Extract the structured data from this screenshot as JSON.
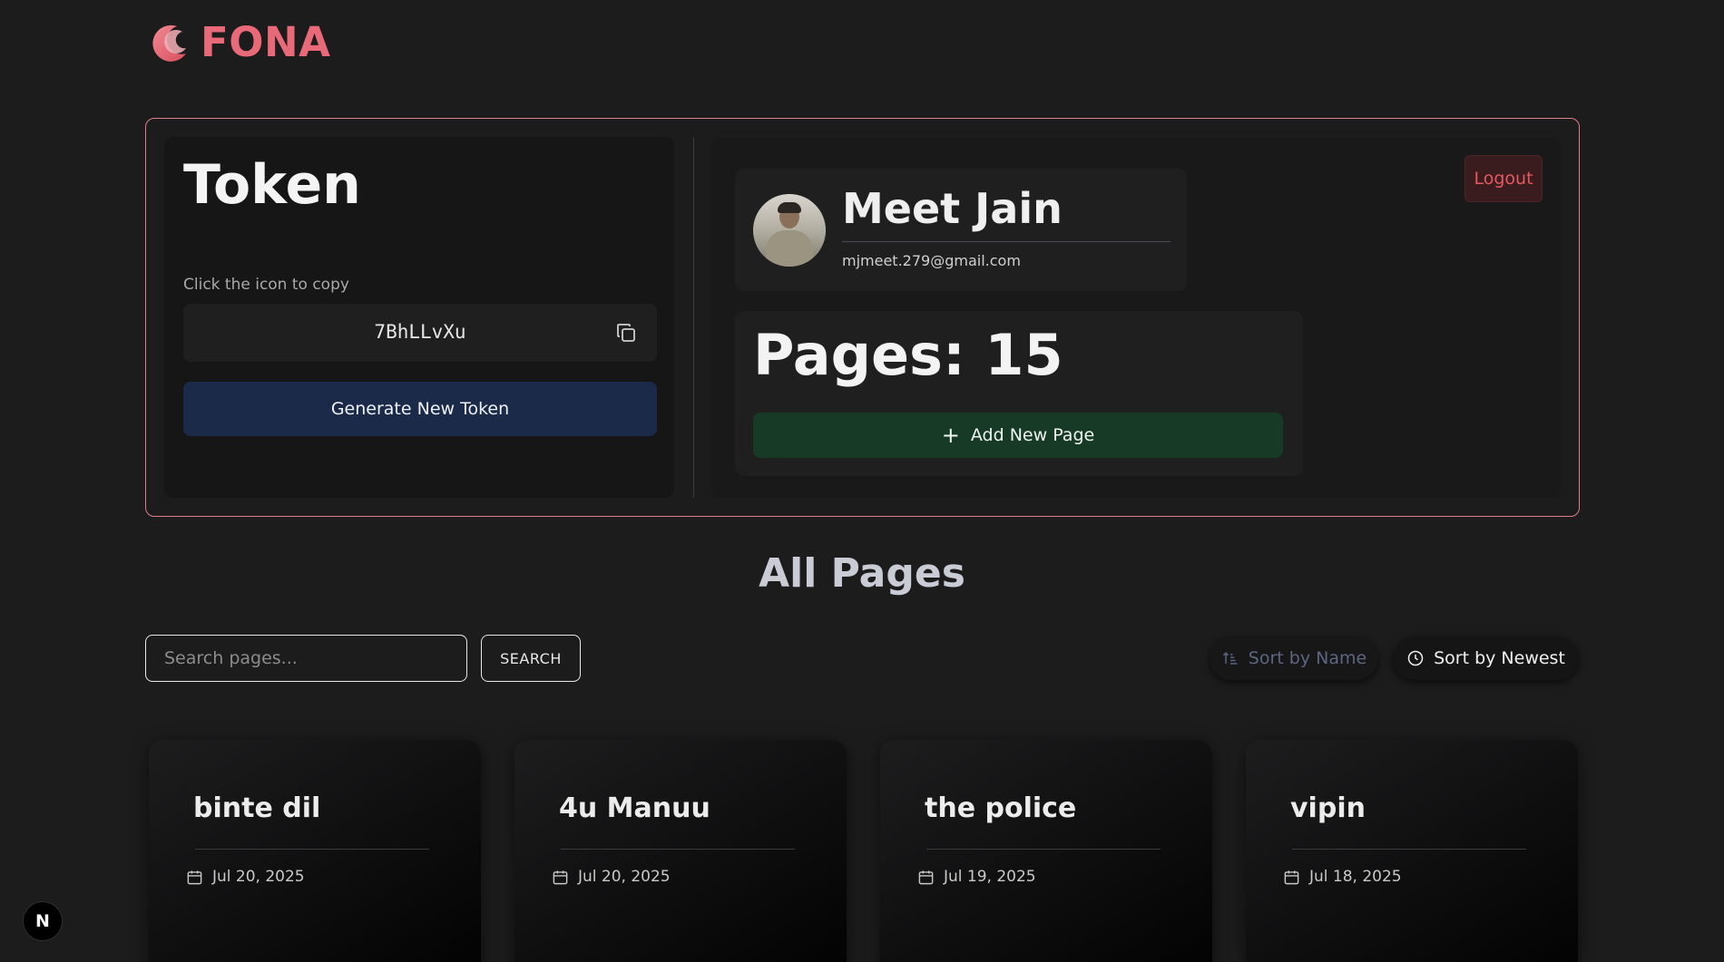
{
  "brand": {
    "name": "FONA",
    "color": "#e86a78"
  },
  "token_panel": {
    "title": "Token",
    "copy_hint": "Click the icon to copy",
    "token_value": "7BhLLvXu",
    "copy_icon": "copy-icon",
    "generate_label": "Generate New Token"
  },
  "profile": {
    "name": "Meet Jain",
    "email": "mjmeet.279@gmail.com",
    "logout_label": "Logout",
    "pages_label": "Pages: 15",
    "add_page_label": "Add New Page"
  },
  "all_pages": {
    "title": "All Pages",
    "search_placeholder": "Search pages...",
    "search_label": "SEARCH",
    "sort_name_label": "Sort by Name",
    "sort_newest_label": "Sort by Newest",
    "cards": [
      {
        "title": "binte dil",
        "date": "Jul 20, 2025"
      },
      {
        "title": "4u Manuu",
        "date": "Jul 20, 2025"
      },
      {
        "title": "the police",
        "date": "Jul 19, 2025"
      },
      {
        "title": "vipin",
        "date": "Jul 18, 2025"
      }
    ]
  },
  "dev_badge": {
    "label": "N"
  },
  "colors": {
    "background": "#1c1c1d",
    "panel_border": "#e07c86",
    "generate_button": "#1b2a48",
    "add_button": "#173a27",
    "logout_text": "#e4585f"
  }
}
